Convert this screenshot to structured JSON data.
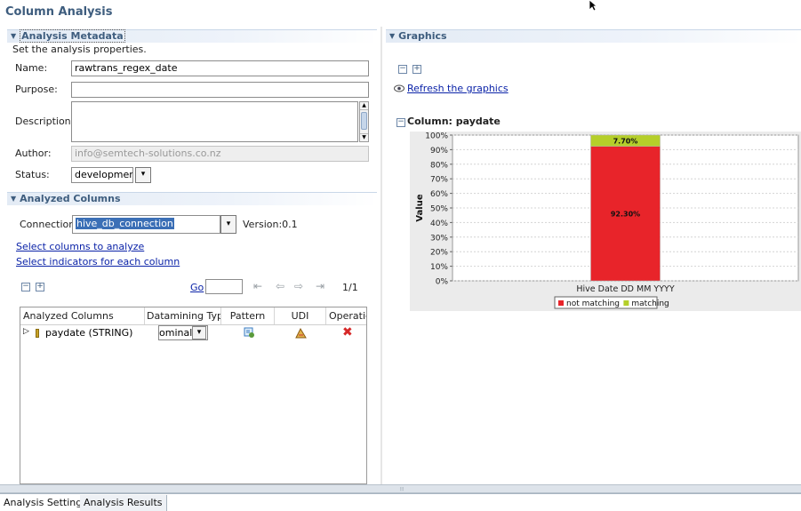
{
  "page": {
    "title": "Column Analysis"
  },
  "metadata": {
    "section_title": "Analysis Metadata",
    "subtitle": "Set the analysis properties.",
    "name_label": "Name:",
    "name_value": "rawtrans_regex_date",
    "purpose_label": "Purpose:",
    "purpose_value": "",
    "description_label": "Description:",
    "description_value": "",
    "author_label": "Author:",
    "author_value": "info@semtech-solutions.co.nz",
    "status_label": "Status:",
    "status_value": "development"
  },
  "analyzed": {
    "section_title": "Analyzed Columns",
    "connection_label": "Connection:",
    "connection_value": "hive_db_connection",
    "version_text": "Version:0.1",
    "select_columns_link": "Select columns to analyze",
    "select_indicators_link": "Select indicators for each column",
    "go_label": "Go",
    "page_text": "1/1",
    "table": {
      "headers": [
        "Analyzed Columns",
        "Datamining Type",
        "Pattern",
        "UDI",
        "Operatic"
      ],
      "rows": [
        {
          "column": "paydate (STRING)",
          "datamining_type": "ominal"
        }
      ]
    }
  },
  "graphics": {
    "section_title": "Graphics",
    "refresh_link": "Refresh the graphics",
    "column_title": "Column: paydate"
  },
  "chart_data": {
    "type": "bar",
    "stacked": true,
    "categories": [
      "Hive Date DD MM YYYY"
    ],
    "series": [
      {
        "name": "not matching",
        "values": [
          92.3
        ],
        "label": "92.30%",
        "color": "#e8242a"
      },
      {
        "name": "matching",
        "values": [
          7.7
        ],
        "label": "7.70%",
        "color": "#b5cf2a"
      }
    ],
    "ylabel": "Value",
    "xlabel": "",
    "ylim": [
      0,
      100
    ],
    "yticks": [
      "0%",
      "10%",
      "20%",
      "30%",
      "40%",
      "50%",
      "60%",
      "70%",
      "80%",
      "90%",
      "100%"
    ],
    "legend": "bottom",
    "grid": true
  },
  "tabs": [
    {
      "label": "Analysis Settings",
      "active": true
    },
    {
      "label": "Analysis Results",
      "active": false
    }
  ]
}
